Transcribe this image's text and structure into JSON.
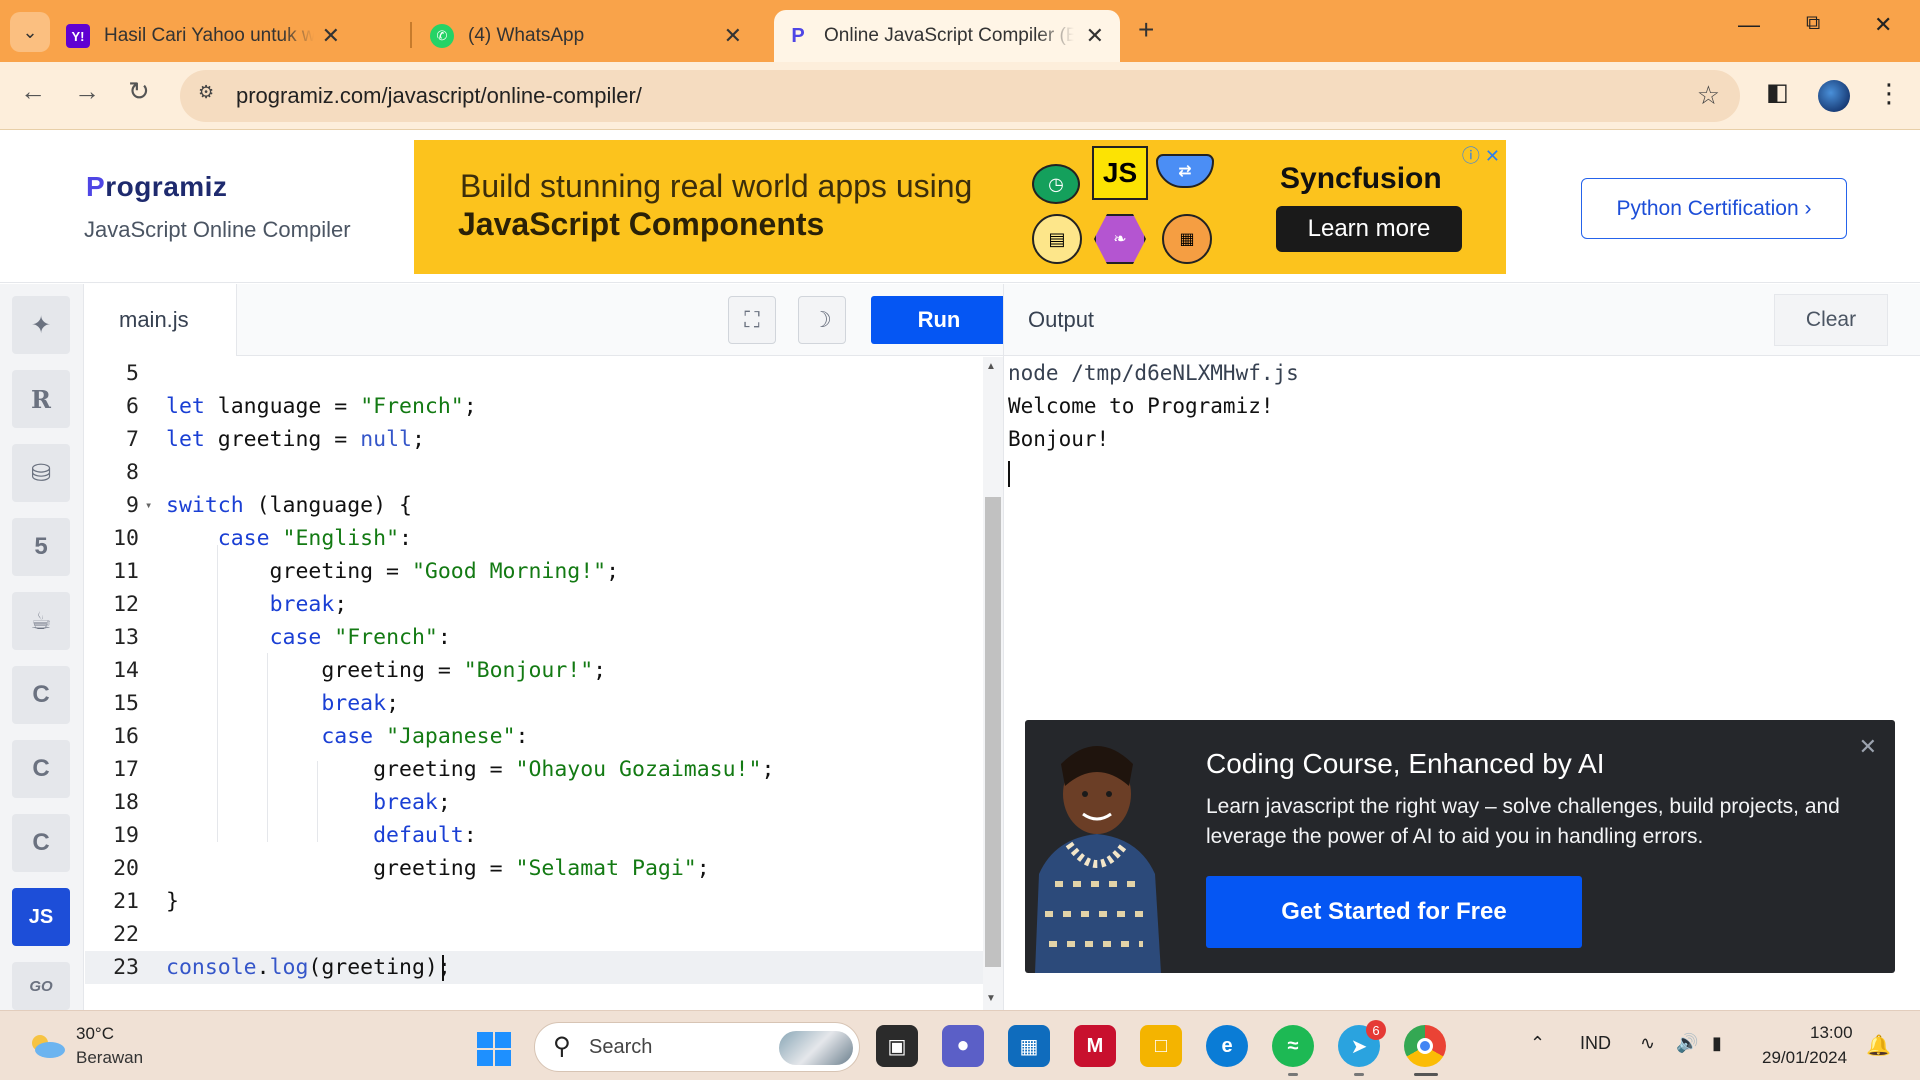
{
  "browser": {
    "tabs": [
      {
        "title": "Hasil Cari Yahoo untuk whatsapp",
        "favicon": "yahoo-icon"
      },
      {
        "title": "(4) WhatsApp",
        "favicon": "whatsapp-icon"
      },
      {
        "title": "Online JavaScript Compiler (Editor)",
        "favicon": "programiz-icon",
        "active": true
      }
    ],
    "url": "programiz.com/javascript/online-compiler/"
  },
  "header": {
    "logo_p": "P",
    "logo_rest": "rogramiz",
    "subtitle": "JavaScript Online Compiler",
    "ad": {
      "line1": "Build stunning real world apps using",
      "line2": "JavaScript Components",
      "badge_js": "JS",
      "brand": "Syncfusion",
      "cta": "Learn more"
    },
    "cert_button": "Python Certification ›"
  },
  "sidebar": {
    "items": [
      {
        "name": "python",
        "icon": "python-icon"
      },
      {
        "name": "r",
        "icon": "r-icon"
      },
      {
        "name": "sql",
        "icon": "database-icon"
      },
      {
        "name": "html",
        "icon": "html5-icon"
      },
      {
        "name": "java",
        "icon": "java-icon"
      },
      {
        "name": "c",
        "icon": "c-icon"
      },
      {
        "name": "cpp",
        "icon": "cpp-icon"
      },
      {
        "name": "csharp",
        "icon": "csharp-icon"
      },
      {
        "name": "js",
        "label": "JS",
        "active": true
      },
      {
        "name": "go",
        "label": "GO"
      }
    ]
  },
  "editor": {
    "file_name": "main.js",
    "run_label": "Run",
    "lines": [
      {
        "n": "5",
        "tokens": []
      },
      {
        "n": "6",
        "tokens": [
          [
            "kw",
            "let"
          ],
          [
            "p",
            " language = "
          ],
          [
            "str",
            "\"French\""
          ],
          [
            "p",
            ";"
          ]
        ]
      },
      {
        "n": "7",
        "tokens": [
          [
            "kw",
            "let"
          ],
          [
            "p",
            " greeting = "
          ],
          [
            "nullv",
            "null"
          ],
          [
            "p",
            ";"
          ]
        ]
      },
      {
        "n": "8",
        "tokens": []
      },
      {
        "n": "9",
        "fold": true,
        "tokens": [
          [
            "kw",
            "switch"
          ],
          [
            "p",
            " (language) {"
          ]
        ]
      },
      {
        "n": "10",
        "tokens": [
          [
            "p",
            "    "
          ],
          [
            "kw",
            "case"
          ],
          [
            "p",
            " "
          ],
          [
            "str",
            "\"English\""
          ],
          [
            "p",
            ":"
          ]
        ]
      },
      {
        "n": "11",
        "tokens": [
          [
            "p",
            "        greeting = "
          ],
          [
            "str",
            "\"Good Morning!\""
          ],
          [
            "p",
            ";"
          ]
        ]
      },
      {
        "n": "12",
        "tokens": [
          [
            "p",
            "        "
          ],
          [
            "kw",
            "break"
          ],
          [
            "p",
            ";"
          ]
        ]
      },
      {
        "n": "13",
        "tokens": [
          [
            "p",
            "        "
          ],
          [
            "kw",
            "case"
          ],
          [
            "p",
            " "
          ],
          [
            "str",
            "\"French\""
          ],
          [
            "p",
            ":"
          ]
        ]
      },
      {
        "n": "14",
        "tokens": [
          [
            "p",
            "            greeting = "
          ],
          [
            "str",
            "\"Bonjour!\""
          ],
          [
            "p",
            ";"
          ]
        ]
      },
      {
        "n": "15",
        "tokens": [
          [
            "p",
            "            "
          ],
          [
            "kw",
            "break"
          ],
          [
            "p",
            ";"
          ]
        ]
      },
      {
        "n": "16",
        "tokens": [
          [
            "p",
            "            "
          ],
          [
            "kw",
            "case"
          ],
          [
            "p",
            " "
          ],
          [
            "str",
            "\"Japanese\""
          ],
          [
            "p",
            ":"
          ]
        ]
      },
      {
        "n": "17",
        "tokens": [
          [
            "p",
            "                greeting = "
          ],
          [
            "str",
            "\"Ohayou Gozaimasu!\""
          ],
          [
            "p",
            ";"
          ]
        ]
      },
      {
        "n": "18",
        "tokens": [
          [
            "p",
            "                "
          ],
          [
            "kw",
            "break"
          ],
          [
            "p",
            ";"
          ]
        ]
      },
      {
        "n": "19",
        "tokens": [
          [
            "p",
            "                "
          ],
          [
            "kw",
            "default"
          ],
          [
            "p",
            ":"
          ]
        ]
      },
      {
        "n": "20",
        "tokens": [
          [
            "p",
            "                greeting = "
          ],
          [
            "str",
            "\"Selamat Pagi\""
          ],
          [
            "p",
            ";"
          ]
        ]
      },
      {
        "n": "21",
        "tokens": [
          [
            "p",
            "}"
          ]
        ]
      },
      {
        "n": "22",
        "tokens": []
      },
      {
        "n": "23",
        "current": true,
        "tokens": [
          [
            "fn",
            "console"
          ],
          [
            "p",
            "."
          ],
          [
            "fn",
            "log"
          ],
          [
            "p",
            "(greeting);"
          ]
        ]
      }
    ]
  },
  "output": {
    "label": "Output",
    "clear_label": "Clear",
    "lines": [
      "node /tmp/d6eNLXMHwf.js",
      "Welcome to Programiz!",
      "Bonjour!"
    ]
  },
  "promo": {
    "title": "Coding Course, Enhanced by AI",
    "description": "Learn javascript the right way – solve challenges, build projects, and leverage the power of AI to aid you in handling errors.",
    "cta": "Get Started for Free"
  },
  "taskbar": {
    "temperature": "30°C",
    "weather": "Berawan",
    "search_label": "Search",
    "telegram_badge": "6",
    "language": "IND",
    "time": "13:00",
    "date": "29/01/2024"
  },
  "colors": {
    "tabbar": "#f9a34a",
    "run_button": "#0556f3",
    "js_active": "#1d4ed8",
    "keyword": "#1a3fd4",
    "string": "#137a13",
    "ad_background": "#fcc31d",
    "promo_background": "#25272b"
  }
}
